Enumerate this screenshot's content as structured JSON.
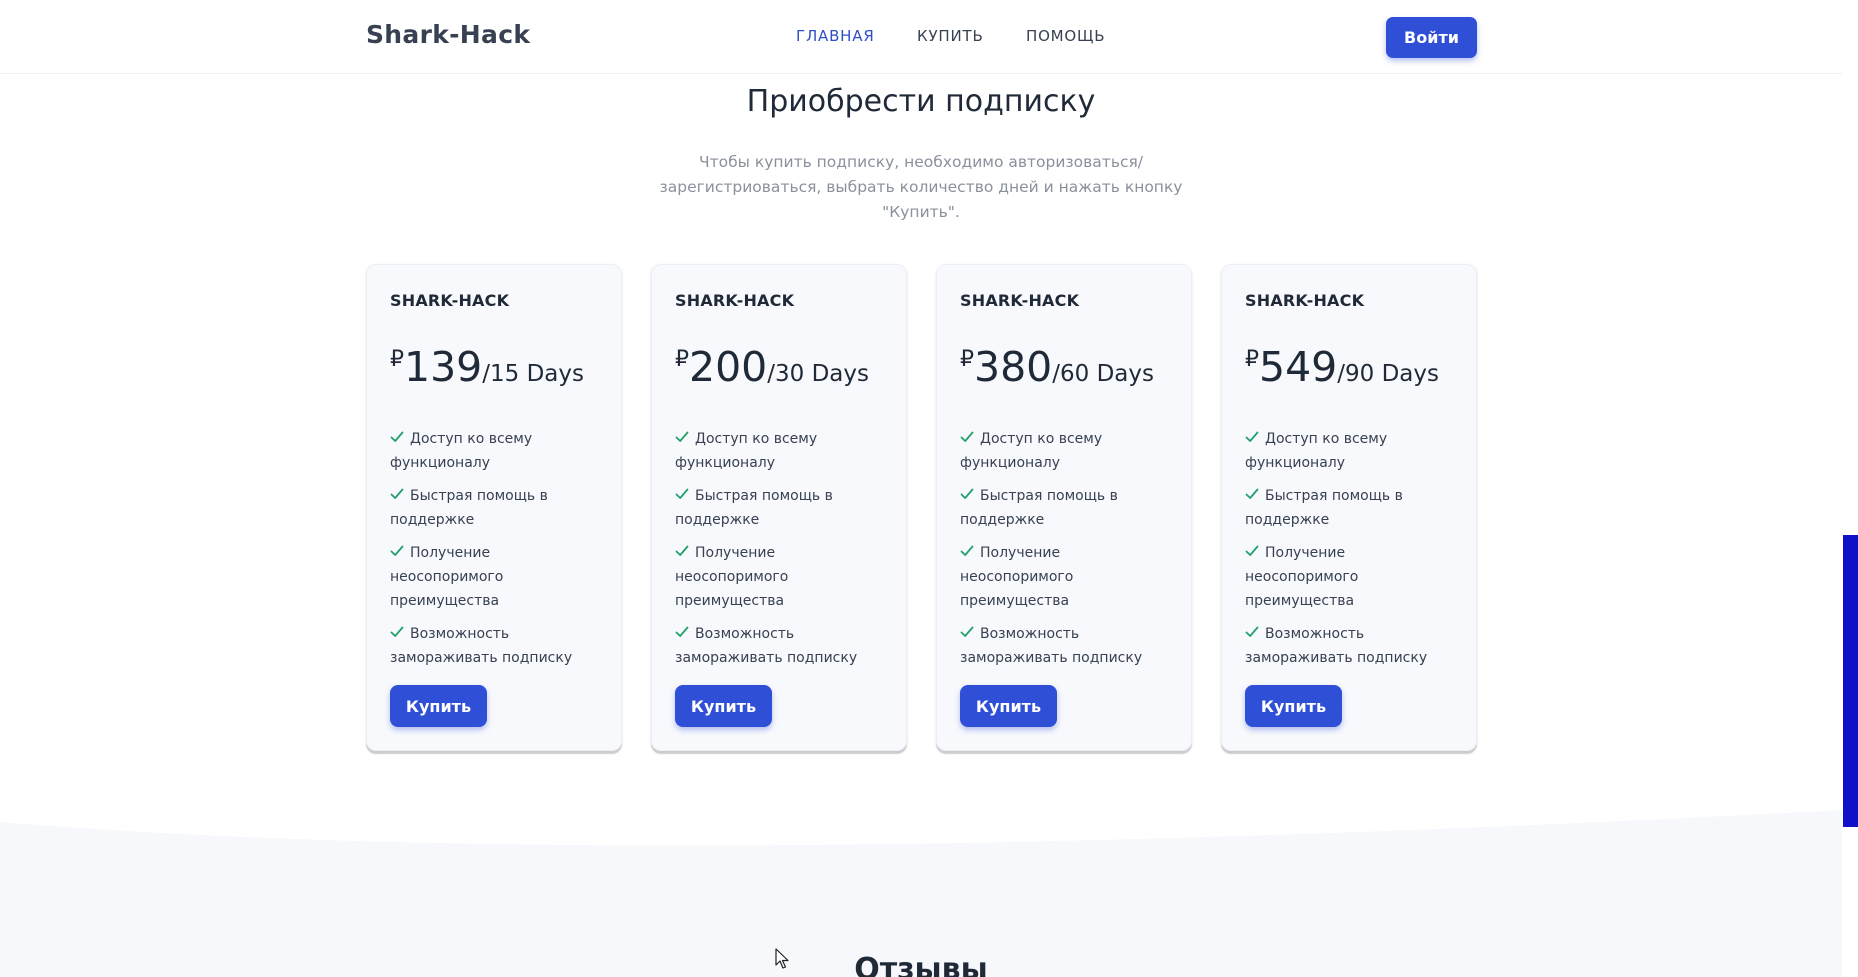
{
  "header": {
    "logo": "Shark-Hack",
    "nav": [
      {
        "label": "ГЛАВНАЯ",
        "active": true
      },
      {
        "label": "КУПИТЬ",
        "active": false
      },
      {
        "label": "ПОМОЩЬ",
        "active": false
      }
    ],
    "login_label": "Войти"
  },
  "pricing": {
    "title": "Приобрести подписку",
    "subtitle": "Чтобы купить подписку, необходимо авторизоваться/зарегистриоваться, выбрать количество дней и нажать кнопку \"Купить\".",
    "currency_symbol": "₽",
    "plans": [
      {
        "name": "SHARK-HACK",
        "price": "139",
        "period": "/15 Days",
        "features": [
          "Доступ ко всему функционалу",
          "Быстрая помощь в поддержке",
          "Получение неосопоримого преимущества",
          "Возможность замораживать подписку"
        ],
        "button_label": "Купить"
      },
      {
        "name": "SHARK-HACK",
        "price": "200",
        "period": "/30 Days",
        "features": [
          "Доступ ко всему функционалу",
          "Быстрая помощь в поддержке",
          "Получение неосопоримого преимущества",
          "Возможность замораживать подписку"
        ],
        "button_label": "Купить"
      },
      {
        "name": "SHARK-HACK",
        "price": "380",
        "period": "/60 Days",
        "features": [
          "Доступ ко всему функционалу",
          "Быстрая помощь в поддержке",
          "Получение неосопоримого преимущества",
          "Возможность замораживать подписку"
        ],
        "button_label": "Купить"
      },
      {
        "name": "SHARK-HACK",
        "price": "549",
        "period": "/90 Days",
        "features": [
          "Доступ ко всему функционалу",
          "Быстрая помощь в поддержке",
          "Получение неосопоримого преимущества",
          "Возможность замораживать подписку"
        ],
        "button_label": "Купить"
      }
    ]
  },
  "reviews": {
    "title": "Отзывы"
  },
  "colors": {
    "accent": "#2f4fd6",
    "nav_active": "#2f4fc9",
    "check": "#22a06b",
    "card_bg": "#f8f9fc",
    "scrollbar_thumb": "#1010c8"
  },
  "icons": {
    "feature": "check-icon",
    "cursor": "mouse-pointer-icon"
  }
}
